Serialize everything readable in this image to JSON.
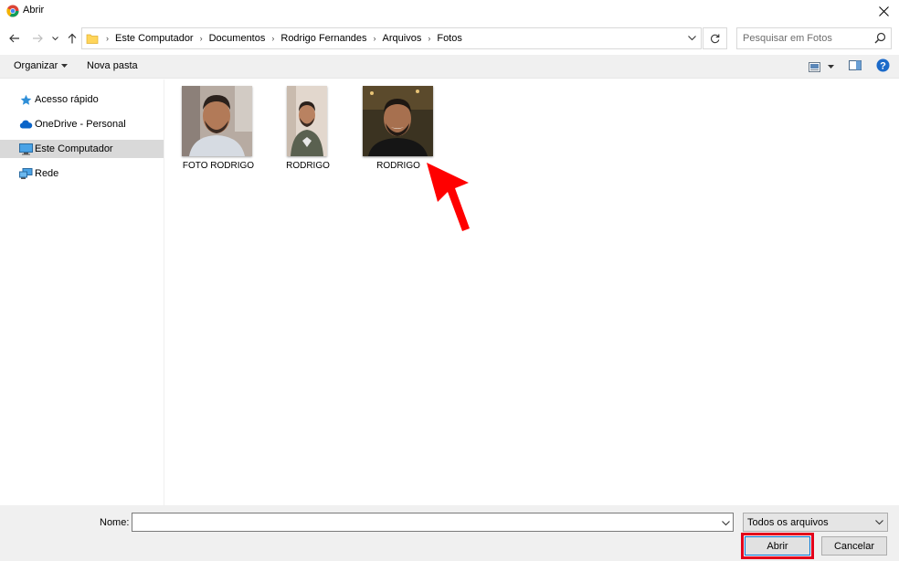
{
  "window": {
    "title": "Abrir",
    "close_glyph": "✕"
  },
  "address": {
    "crumbs": [
      "Este Computador",
      "Documentos",
      "Rodrigo Fernandes",
      "Arquivos",
      "Fotos"
    ],
    "separator": "›"
  },
  "search": {
    "placeholder": "Pesquisar em Fotos"
  },
  "toolbar": {
    "organize_label": "Organizar",
    "new_folder_label": "Nova pasta"
  },
  "sidebar": {
    "items": [
      {
        "label": "Acesso rápido",
        "icon": "star-icon",
        "selected": false
      },
      {
        "label": "OneDrive - Personal",
        "icon": "cloud-icon",
        "selected": false
      },
      {
        "label": "Este Computador",
        "icon": "computer-icon",
        "selected": true
      },
      {
        "label": "Rede",
        "icon": "network-icon",
        "selected": false
      }
    ]
  },
  "files": [
    {
      "name": "FOTO RODRIGO"
    },
    {
      "name": "RODRIGO"
    },
    {
      "name": "RODRIGO"
    }
  ],
  "bottom": {
    "name_label": "Nome:",
    "name_value": "",
    "filetype": "Todos os arquivos",
    "open_label": "Abrir",
    "cancel_label": "Cancelar"
  },
  "colors": {
    "highlight": "#e3001b",
    "arrow": "#ff0000",
    "selection": "#d9d9d9",
    "accent": "#0078d7"
  }
}
